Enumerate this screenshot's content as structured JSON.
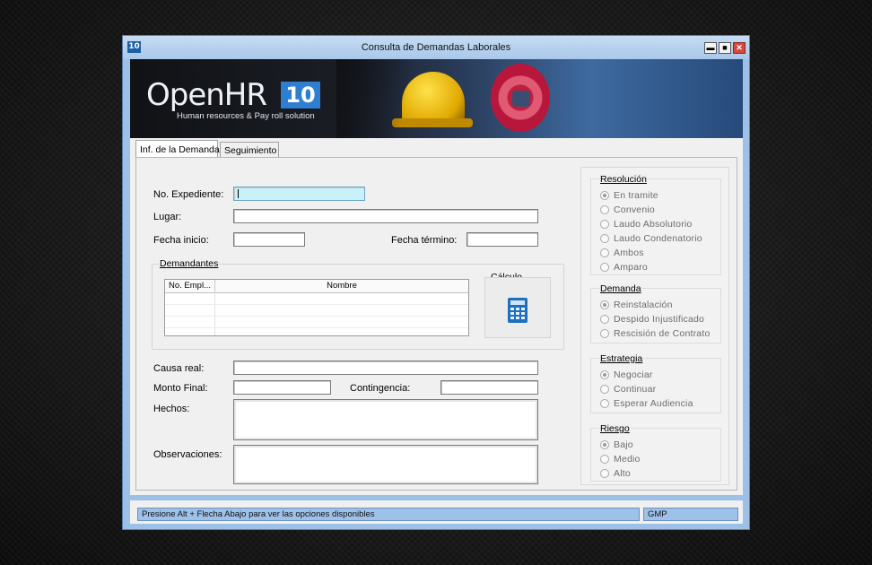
{
  "window": {
    "title": "Consulta de Demandas Laborales",
    "icon_text": "10",
    "minimize_glyph": "▬",
    "maximize_glyph": "■",
    "close_glyph": "✕"
  },
  "banner": {
    "logo_text": "OpenHR",
    "logo_version": "10",
    "tagline": "Human resources & Pay roll solution"
  },
  "tabs": [
    {
      "label": "Inf. de la Demanda",
      "active": true
    },
    {
      "label": "Seguimiento",
      "active": false
    }
  ],
  "form": {
    "expediente_label": "No. Expediente:",
    "expediente_value": "",
    "lugar_label": "Lugar:",
    "lugar_value": "",
    "fecha_inicio_label": "Fecha inicio:",
    "fecha_inicio_value": "",
    "fecha_termino_label": "Fecha término:",
    "fecha_termino_value": "",
    "causa_label": "Causa real:",
    "causa_value": "",
    "monto_label": "Monto Final:",
    "monto_value": "",
    "contingencia_label": "Contingencia:",
    "contingencia_value": "",
    "hechos_label": "Hechos:",
    "hechos_value": "",
    "observaciones_label": "Observaciones:",
    "observaciones_value": ""
  },
  "demandantes": {
    "title": "Demandantes",
    "columns": [
      "No. Empl...",
      "Nombre"
    ],
    "rows": []
  },
  "calculo": {
    "title": "Cálculo",
    "icon": "calculator-icon"
  },
  "resolucion": {
    "title": "Resolución",
    "options": [
      {
        "label": "En tramite",
        "checked": true
      },
      {
        "label": "Convenio",
        "checked": false
      },
      {
        "label": "Laudo Absolutorio",
        "checked": false
      },
      {
        "label": "Laudo Condenatorio",
        "checked": false
      },
      {
        "label": "Ambos",
        "checked": false
      },
      {
        "label": "Amparo",
        "checked": false
      }
    ]
  },
  "demanda": {
    "title": "Demanda",
    "options": [
      {
        "label": "Reinstalación",
        "checked": true
      },
      {
        "label": "Despido Injustificado",
        "checked": false
      },
      {
        "label": "Rescisión de Contrato",
        "checked": false
      }
    ]
  },
  "estrategia": {
    "title": "Estrategia",
    "options": [
      {
        "label": "Negociar",
        "checked": true
      },
      {
        "label": "Continuar",
        "checked": false
      },
      {
        "label": "Esperar Audiencia",
        "checked": false
      }
    ]
  },
  "riesgo": {
    "title": "Riesgo",
    "options": [
      {
        "label": "Bajo",
        "checked": true
      },
      {
        "label": "Medio",
        "checked": false
      },
      {
        "label": "Alto",
        "checked": false
      }
    ]
  },
  "status": {
    "hint": "Presione Alt + Flecha Abajo para ver las opciones disponibles",
    "code": "GMP"
  },
  "colors": {
    "accent": "#2f7fd0",
    "status_bar": "#9ec1ea",
    "focus_field": "#c8f1f8",
    "close_button": "#d9463b"
  }
}
